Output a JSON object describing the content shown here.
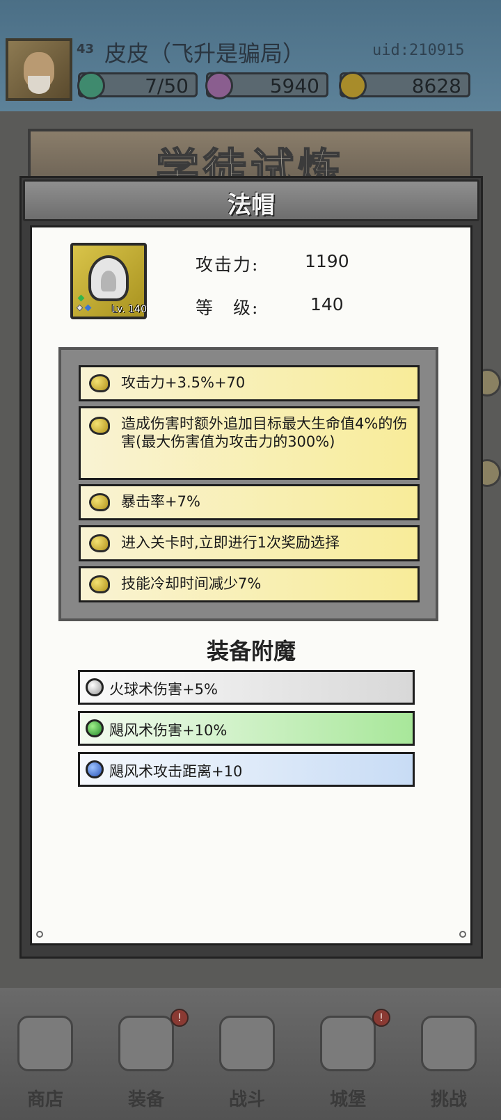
{
  "player": {
    "level": "43",
    "name": "皮皮（飞升是骗局）",
    "uid": "uid:210915"
  },
  "resources": [
    {
      "name": "stamina",
      "icon": "green-gem-icon",
      "value": "7/50",
      "color": "#3f8a6e"
    },
    {
      "name": "diamonds",
      "icon": "pink-diamond-icon",
      "value": "5940",
      "color": "#8a5e8f"
    },
    {
      "name": "gold",
      "icon": "gold-coin-icon",
      "value": "8628",
      "color": "#a88c2a"
    }
  ],
  "background": {
    "banner_text": "学徒试炼"
  },
  "modal": {
    "title": "法帽",
    "item": {
      "level_tag": "Lv. 140",
      "attack_label": "攻击力:",
      "attack_value": "1190",
      "level_label": "等　级:",
      "level_value": "140"
    },
    "affixes": [
      "攻击力+3.5%+70",
      "造成伤害时额外追加目标最大生命值4%的伤害(最大伤害值为攻击力的300%)",
      "暴击率+7%",
      "进入关卡时,立即进行1次奖励选择",
      "技能冷却时间减少7%"
    ],
    "enchant": {
      "title": "装备附魔",
      "items": [
        {
          "text": "火球术伤害+5%",
          "gem": "white-gem-icon",
          "color": "#d8d8d8"
        },
        {
          "text": "飓风术伤害+10%",
          "gem": "green-gem-icon",
          "color": "#a8e79a"
        },
        {
          "text": "飓风术攻击距离+10",
          "gem": "blue-gem-icon",
          "color": "#c8dcf5"
        }
      ]
    }
  },
  "nav": [
    {
      "label": "商店",
      "badge": ""
    },
    {
      "label": "装备",
      "badge": "!"
    },
    {
      "label": "战斗",
      "badge": ""
    },
    {
      "label": "城堡",
      "badge": "!"
    },
    {
      "label": "挑战",
      "badge": ""
    }
  ]
}
